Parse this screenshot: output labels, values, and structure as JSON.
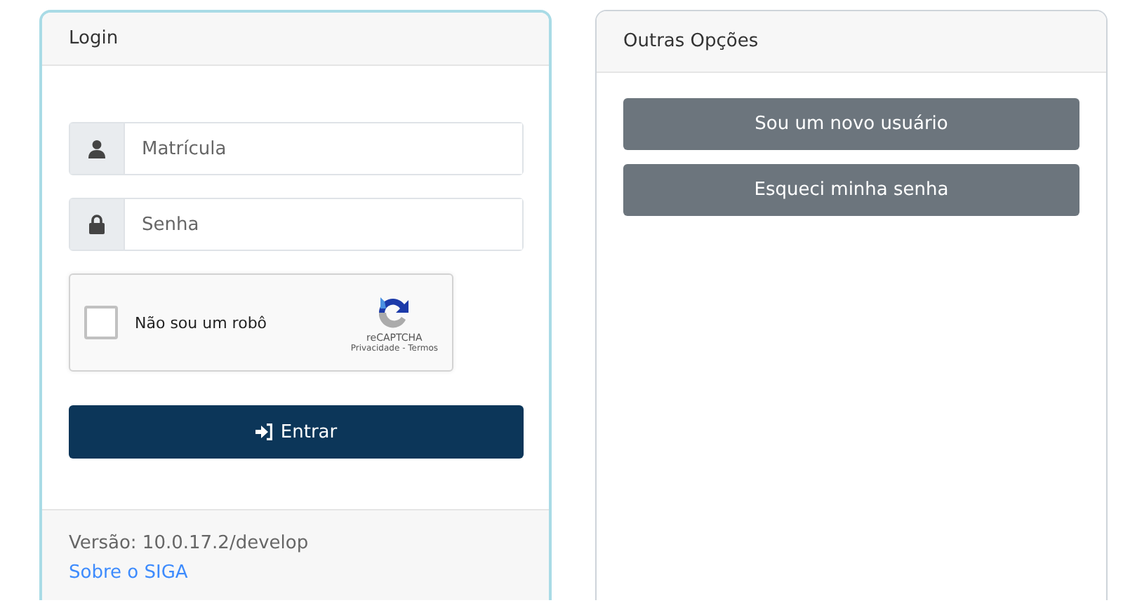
{
  "login": {
    "title": "Login",
    "fields": [
      {
        "kind": "user",
        "placeholder": "Matrícula"
      },
      {
        "kind": "lock",
        "placeholder": "Senha"
      }
    ],
    "captcha": {
      "label": "Não sou um robô",
      "checked": false,
      "brand": "reCAPTCHA",
      "links": "Privacidade - Termos"
    },
    "submit": "Entrar",
    "version": "Versão: 10.0.17.2/develop",
    "about_link": "Sobre o SIGA"
  },
  "other": {
    "title": "Outras Opções",
    "buttons": [
      "Sou um novo usuário",
      "Esqueci minha senha"
    ]
  }
}
